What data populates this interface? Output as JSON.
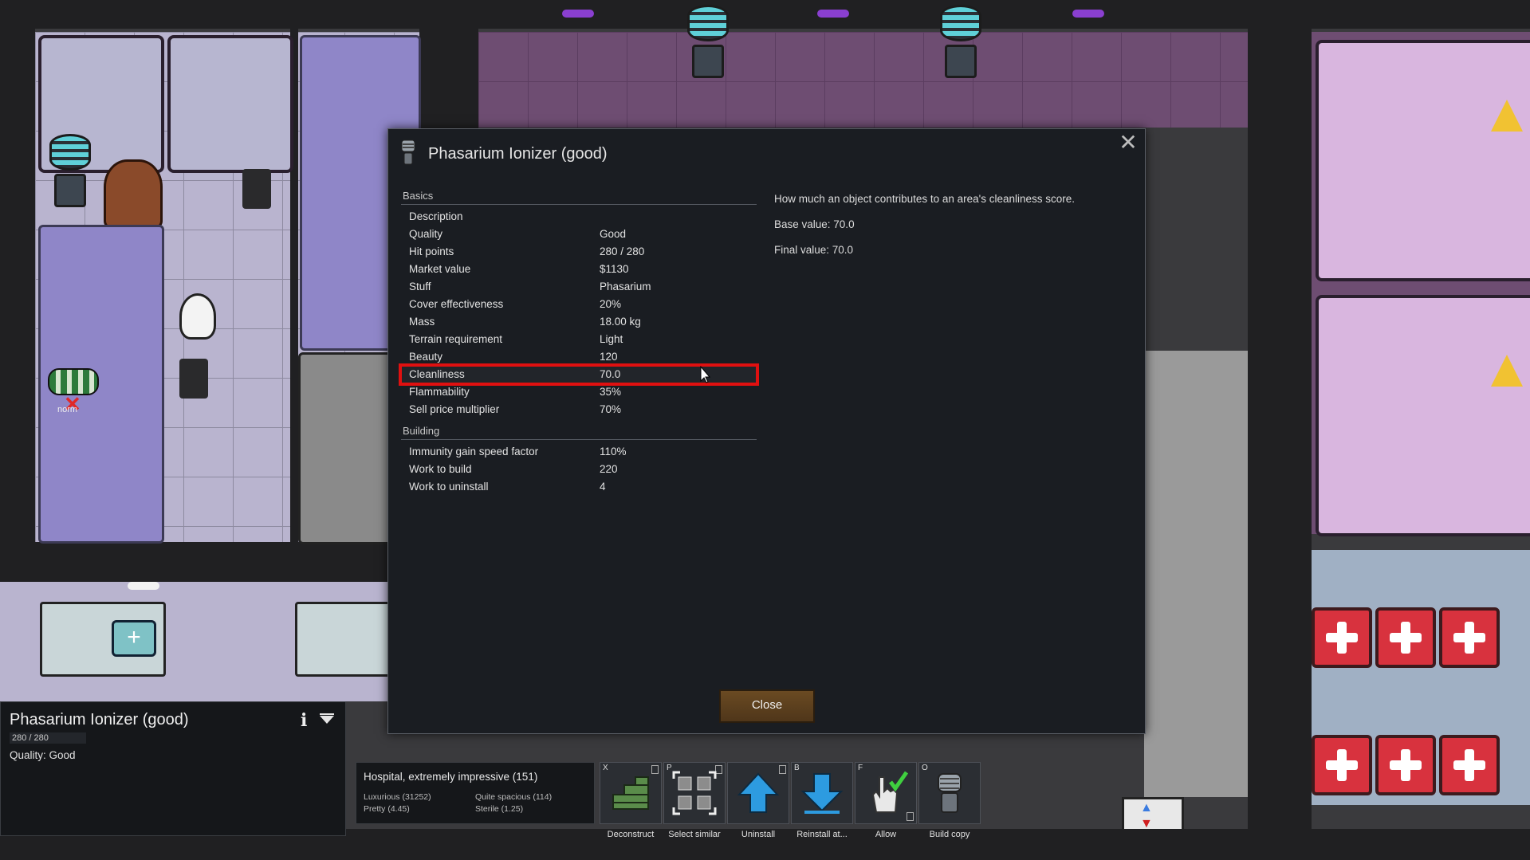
{
  "map": {
    "pawn_label": "norm"
  },
  "dialog": {
    "title": "Phasarium Ionizer (good)",
    "close_label": "Close",
    "sections": [
      {
        "heading": "Basics",
        "rows": [
          {
            "label": "Description",
            "value": ""
          },
          {
            "label": "Quality",
            "value": "Good"
          },
          {
            "label": "Hit points",
            "value": "280 / 280"
          },
          {
            "label": "Market value",
            "value": "$1130"
          },
          {
            "label": "Stuff",
            "value": "Phasarium"
          },
          {
            "label": "Cover effectiveness",
            "value": "20%"
          },
          {
            "label": "Mass",
            "value": "18.00 kg"
          },
          {
            "label": "Terrain requirement",
            "value": "Light"
          },
          {
            "label": "Beauty",
            "value": "120"
          },
          {
            "label": "Cleanliness",
            "value": "70.0"
          },
          {
            "label": "Flammability",
            "value": "35%"
          },
          {
            "label": "Sell price multiplier",
            "value": "70%"
          }
        ]
      },
      {
        "heading": "Building",
        "rows": [
          {
            "label": "Immunity gain speed factor",
            "value": "110%"
          },
          {
            "label": "Work to build",
            "value": "220"
          },
          {
            "label": "Work to uninstall",
            "value": "4"
          }
        ]
      }
    ],
    "description": {
      "line1": "How much an object contributes to an area's cleanliness score.",
      "line2": "Base value: 70.0",
      "line3": "Final value: 70.0"
    }
  },
  "inspect": {
    "title": "Phasarium Ionizer (good)",
    "hit_points": "280 / 280",
    "quality": "Quality: Good"
  },
  "room": {
    "heading": "Hospital, extremely impressive (151)",
    "stats": [
      "Luxurious (31252)",
      "Quite spacious (114)",
      "Pretty (4.45)",
      "Sterile (1.25)"
    ]
  },
  "gizmos": [
    {
      "hotkey": "X",
      "label": "Deconstruct"
    },
    {
      "hotkey": "P",
      "label": "Select similar"
    },
    {
      "hotkey": "",
      "label": "Uninstall"
    },
    {
      "hotkey": "B",
      "label": "Reinstall at..."
    },
    {
      "hotkey": "F",
      "label": "Allow"
    },
    {
      "hotkey": "O",
      "label": "Build copy"
    }
  ],
  "colors": {
    "highlight": "#e01010",
    "dialog_bg": "#1a1d22",
    "button_bg": "#5d4120"
  }
}
